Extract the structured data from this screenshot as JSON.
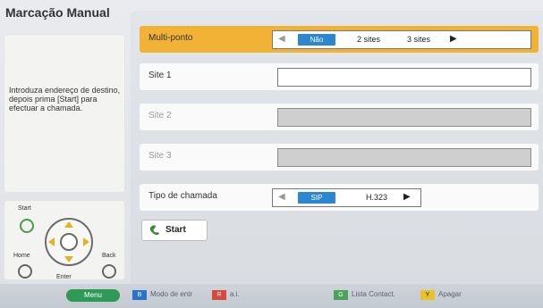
{
  "title": "Marcação Manual",
  "info": "Introduza endereço de destino, depois prima [Start] para efectuar a chamada.",
  "remote": {
    "start": "Start",
    "home": "Home",
    "enter": "Enter",
    "back": "Back"
  },
  "rows": {
    "multiponto": {
      "label": "Multi-ponto",
      "left_arrow": "◀",
      "options": [
        "Não",
        "2 sites",
        "3 sites"
      ],
      "selected": "Não",
      "right_arrow": "▶"
    },
    "site1": {
      "label": "Site 1",
      "value": ""
    },
    "site2": {
      "label": "Site 2",
      "value": ""
    },
    "site3": {
      "label": "Site 3",
      "value": ""
    },
    "tipo": {
      "label": "Tipo de chamada",
      "left_arrow": "◀",
      "options": [
        "SIP",
        "H.323"
      ],
      "selected": "SIP",
      "right_arrow": "▶"
    }
  },
  "start_button": {
    "label": "Start"
  },
  "bottom": {
    "menu": "Menu",
    "b_key": "B",
    "b_text": "Modo de entr",
    "r_key": "R",
    "r_text": "a.i.",
    "g_key": "G",
    "g_text": "Lista Contact.",
    "y_key": "Y",
    "y_text": "Apagar"
  },
  "colors": {
    "highlight": "#f2b236",
    "selected_pill": "#2c86d1",
    "menu": "#2f9a56",
    "key_blue": "#2a73c9",
    "key_red": "#d9473f",
    "key_green": "#4aa35b",
    "key_yellow": "#e8c22b"
  }
}
